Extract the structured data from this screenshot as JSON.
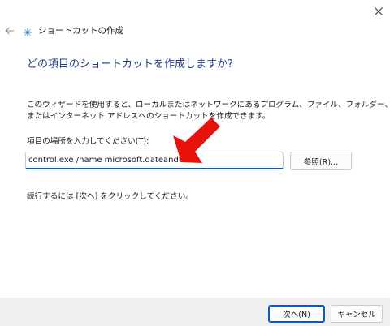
{
  "window": {
    "title": "ショートカットの作成"
  },
  "page": {
    "heading": "どの項目のショートカットを作成しますか?",
    "description_line1": "このウィザードを使用すると、ローカルまたはネットワークにあるプログラム、ファイル、フォルダー、コンピューター、",
    "description_line2": "またはインターネット アドレスへのショートカットを作成できます。",
    "field_label": "項目の場所を入力してください(T):",
    "location_value": "control.exe /name microsoft.dateandtime",
    "browse_label": "参照(R)...",
    "continue_text": "続行するには [次へ] をクリックしてください。"
  },
  "footer": {
    "next_label": "次へ(N)",
    "cancel_label": "キャンセル"
  },
  "icons": {
    "close": "close-icon",
    "back": "back-arrow-icon",
    "wizard": "shortcut-wizard-icon",
    "annotation": "red-arrow-icon"
  },
  "colors": {
    "heading": "#1f3c8a",
    "accent": "#0a5bbd",
    "annotation_arrow": "#e8120c"
  }
}
